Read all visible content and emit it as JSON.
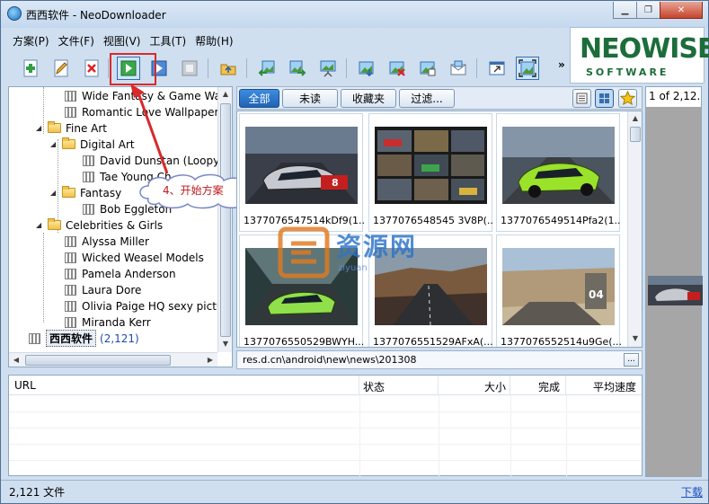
{
  "window": {
    "title": "西西软件 - NeoDownloader",
    "buttons": {
      "minimize": "▁",
      "maximize": "❐",
      "close": "✕"
    }
  },
  "menu": [
    "方案(P)",
    "文件(F)",
    "视图(V)",
    "工具(T)",
    "帮助(H)"
  ],
  "logo": {
    "main": "NEOWISE",
    "sub": "SOFTWARE",
    "color": "#1c6d3a"
  },
  "toolbar": {
    "more": "»",
    "buttons": [
      {
        "name": "new-project-button",
        "icon": "plus-icon"
      },
      {
        "name": "edit-project-button",
        "icon": "pencil-icon"
      },
      {
        "name": "delete-project-button",
        "icon": "red-x-icon"
      },
      {
        "name": "start-project-button",
        "icon": "play-icon"
      },
      {
        "name": "resume-button",
        "icon": "play-blue-icon"
      },
      {
        "name": "stop-button",
        "icon": "stop-icon"
      },
      {
        "name": "open-folder-button",
        "icon": "folder-up-icon"
      },
      {
        "name": "import-button",
        "icon": "image-arrow-left-icon"
      },
      {
        "name": "export-button",
        "icon": "image-arrow-right-icon"
      },
      {
        "name": "slideshow-button",
        "icon": "slideshow-icon"
      },
      {
        "name": "save-image-button",
        "icon": "image-save-icon"
      },
      {
        "name": "delete-image-button",
        "icon": "image-delete-icon"
      },
      {
        "name": "image-properties-button",
        "icon": "image-info-icon"
      },
      {
        "name": "email-button",
        "icon": "mail-icon"
      },
      {
        "name": "window-button",
        "icon": "window-icon"
      },
      {
        "name": "fullscreen-button",
        "icon": "fullscreen-icon"
      }
    ]
  },
  "tree": {
    "items": [
      {
        "label": "Wide Fantasy & Game Wallp",
        "type": "plan",
        "level": 2
      },
      {
        "label": "Romantic Love Wallpapers",
        "type": "plan",
        "level": 2
      },
      {
        "label": "Fine Art",
        "type": "folder",
        "level": 1
      },
      {
        "label": "Digital Art",
        "type": "folder",
        "level": 2
      },
      {
        "label": "David Dunstan (Loopyda",
        "type": "plan",
        "level": 3
      },
      {
        "label": "Tae Young Ch",
        "type": "plan",
        "level": 3
      },
      {
        "label": "Fantasy",
        "type": "folder",
        "level": 2
      },
      {
        "label": "Bob Eggleton",
        "type": "plan",
        "level": 3
      },
      {
        "label": "Celebrities & Girls",
        "type": "folder",
        "level": 1
      },
      {
        "label": "Alyssa Miller",
        "type": "plan",
        "level": 2
      },
      {
        "label": "Wicked Weasel Models",
        "type": "plan",
        "level": 2
      },
      {
        "label": "Pamela Anderson",
        "type": "plan",
        "level": 2
      },
      {
        "label": "Laura Dore",
        "type": "plan",
        "level": 2
      },
      {
        "label": "Olivia Paige HQ sexy picture",
        "type": "plan",
        "level": 2
      },
      {
        "label": "Miranda Kerr",
        "type": "plan",
        "level": 2
      }
    ],
    "root": {
      "label": "西西软件",
      "count": "(2,121)"
    }
  },
  "callout": {
    "text": "4、开始方案",
    "color": "#c0181c"
  },
  "filters": {
    "all": "全部",
    "unread": "未读",
    "favorites": "收藏夹",
    "filter": "过滤..."
  },
  "thumbnails": [
    {
      "caption": "1377076547514kDf9(1..."
    },
    {
      "caption": "1377076548545 3V8P(..."
    },
    {
      "caption": "1377076549514Pfa2(1..."
    },
    {
      "caption": "1377076550529BWYH..."
    },
    {
      "caption": "1377076551529AFxA(..."
    },
    {
      "caption": "1377076552514u9Ge(..."
    }
  ],
  "watermark": {
    "text": "资源网",
    "url": "ziyuan"
  },
  "path": {
    "value": "res.d.cn\\android\\new\\news\\201308",
    "button": "..."
  },
  "pager": {
    "text": "1 of 2,12..."
  },
  "downloads": {
    "columns": [
      "URL",
      "状态",
      "大小",
      "完成",
      "平均速度"
    ]
  },
  "status": {
    "files": "2,121 文件",
    "link": "下载"
  }
}
